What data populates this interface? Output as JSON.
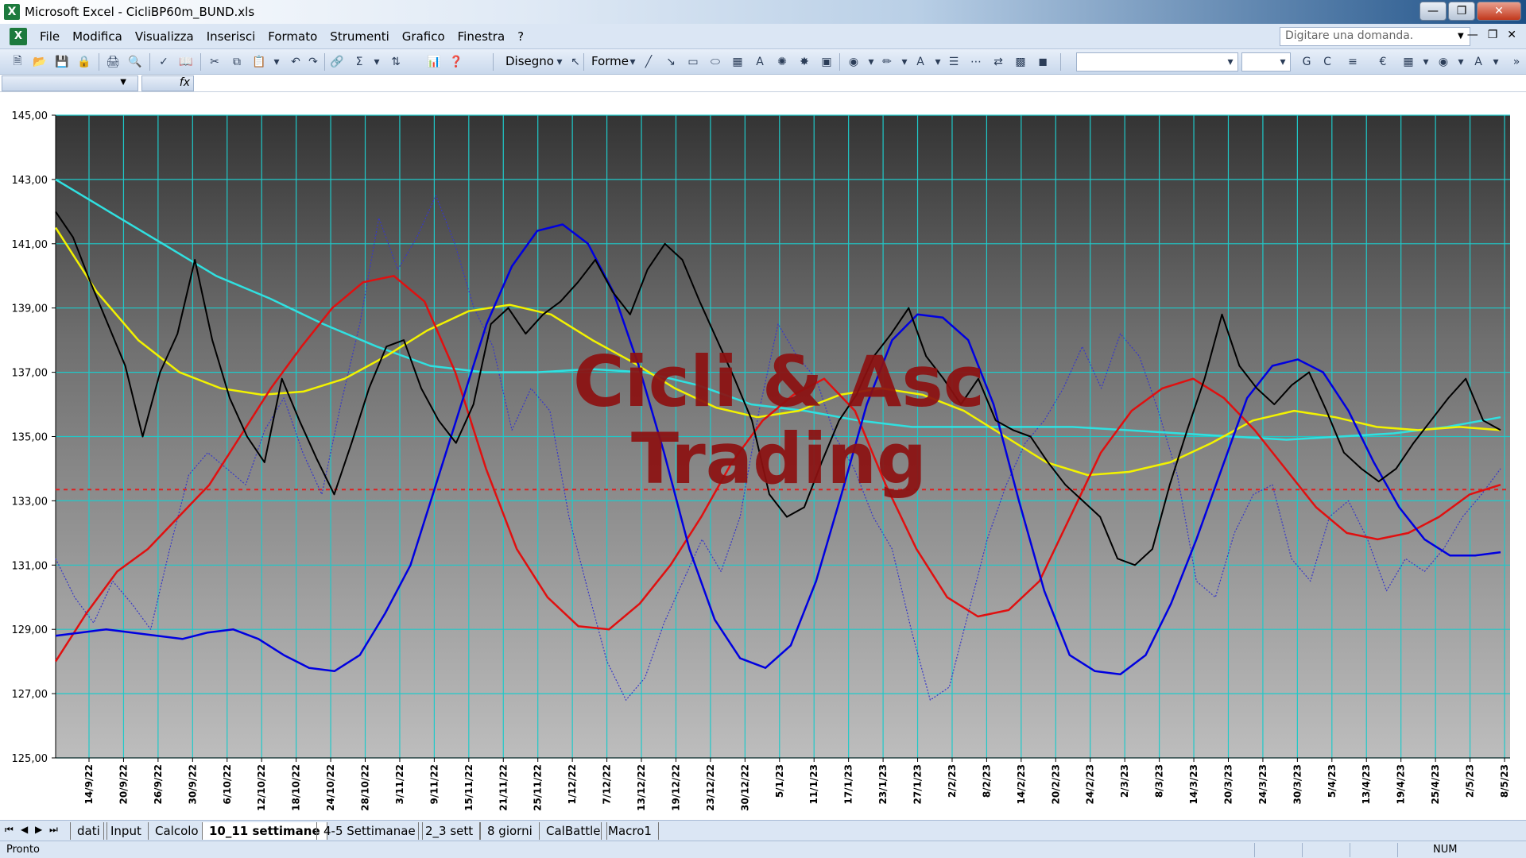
{
  "window": {
    "app_icon": "excel-icon",
    "title": "Microsoft Excel - CicliBP60m_BUND.xls"
  },
  "menu": {
    "items": [
      "File",
      "Modifica",
      "Visualizza",
      "Inserisci",
      "Formato",
      "Strumenti",
      "Grafico",
      "Finestra",
      "?"
    ],
    "ask_placeholder": "Digitare una domanda."
  },
  "toolbar": {
    "draw_label": "Disegno",
    "shapes_label": "Forme"
  },
  "formula": {
    "fx": "fx"
  },
  "sheet_tabs": {
    "labels": [
      "dati",
      "Input",
      "Calcolo",
      "10_11 settimane",
      "4-5 Settimanae",
      "2_3 sett",
      "8 giorni",
      "CalBattle",
      "Macro1"
    ],
    "active": "10_11 settimane"
  },
  "status": {
    "text": "Pronto",
    "num": "NUM"
  },
  "colors": {
    "gridline": "#1fc9c9",
    "price": "#000000",
    "cycle_blue": "#0000e0",
    "ma_red": "#e01010",
    "ma_yellow": "#f2f200",
    "ma_cyan": "#30e0e0",
    "dotted": "#3838c8",
    "hline": "#e02020",
    "watermark": "#8c1010"
  },
  "chart_data": {
    "type": "line",
    "title": "",
    "watermark": [
      "Cicli & Asc",
      "Trading"
    ],
    "ylim": [
      125,
      145
    ],
    "y_ticks": [
      "145,00",
      "143,00",
      "141,00",
      "139,00",
      "137,00",
      "135,00",
      "133,00",
      "131,00",
      "129,00",
      "127,00",
      "125,00"
    ],
    "x_labels": [
      "14/9/22",
      "20/9/22",
      "26/9/22",
      "30/9/22",
      "6/10/22",
      "12/10/22",
      "18/10/22",
      "24/10/22",
      "28/10/22",
      "3/11/22",
      "9/11/22",
      "15/11/22",
      "21/11/22",
      "25/11/22",
      "1/12/22",
      "7/12/22",
      "13/12/22",
      "19/12/22",
      "23/12/22",
      "30/12/22",
      "5/1/23",
      "11/1/23",
      "17/1/23",
      "23/1/23",
      "27/1/23",
      "2/2/23",
      "8/2/23",
      "14/2/23",
      "20/2/23",
      "24/2/23",
      "2/3/23",
      "8/3/23",
      "14/3/23",
      "20/3/23",
      "24/3/23",
      "30/3/23",
      "5/4/23",
      "13/4/23",
      "19/4/23",
      "25/4/23",
      "2/5/23",
      "8/5/23"
    ],
    "horizontal_line": 133.35,
    "grid": true,
    "series": [
      {
        "key": "price",
        "style": "solid-thin",
        "values": [
          142.0,
          141.2,
          139.8,
          138.5,
          137.2,
          135.0,
          137.0,
          138.2,
          140.5,
          138.0,
          136.2,
          135.0,
          134.2,
          136.8,
          135.5,
          134.3,
          133.2,
          134.8,
          136.5,
          137.8,
          138.0,
          136.5,
          135.5,
          134.8,
          136.0,
          138.5,
          139.0,
          138.2,
          138.8,
          139.2,
          139.8,
          140.5,
          139.5,
          138.8,
          140.2,
          141.0,
          140.5,
          139.2,
          138.0,
          136.8,
          135.5,
          133.2,
          132.5,
          132.8,
          134.2,
          135.5,
          136.3,
          137.5,
          138.2,
          139.0,
          137.5,
          136.8,
          136.0,
          136.8,
          135.5,
          135.2,
          135.0,
          134.2,
          133.5,
          133.0,
          132.5,
          131.2,
          131.0,
          131.5,
          133.5,
          135.2,
          136.8,
          138.8,
          137.2,
          136.5,
          136.0,
          136.6,
          137.0,
          135.8,
          134.5,
          134.0,
          133.6,
          134.0,
          134.8,
          135.5,
          136.2,
          136.8,
          135.5,
          135.2
        ]
      },
      {
        "key": "dotted",
        "style": "dotted",
        "values": [
          131.2,
          130.0,
          129.2,
          130.5,
          129.8,
          129.0,
          131.5,
          133.8,
          134.5,
          134.0,
          133.5,
          135.2,
          136.2,
          134.5,
          133.2,
          136.0,
          138.5,
          141.8,
          140.2,
          141.2,
          142.5,
          141.0,
          139.0,
          137.8,
          135.2,
          136.5,
          135.8,
          132.5,
          130.2,
          128.0,
          126.8,
          127.5,
          129.2,
          130.5,
          131.8,
          130.8,
          132.5,
          135.8,
          138.5,
          137.5,
          136.8,
          135.0,
          134.0,
          132.5,
          131.5,
          129.0,
          126.8,
          127.2,
          129.5,
          131.8,
          133.5,
          134.8,
          135.5,
          136.5,
          137.8,
          136.5,
          138.2,
          137.5,
          135.8,
          133.8,
          130.5,
          130.0,
          132.0,
          133.2,
          133.5,
          131.2,
          130.5,
          132.5,
          133.0,
          131.8,
          130.2,
          131.2,
          130.8,
          131.5,
          132.5,
          133.2,
          134.0
        ]
      },
      {
        "key": "cycle_blue",
        "style": "solid",
        "values": [
          128.8,
          128.9,
          129.0,
          128.9,
          128.8,
          128.7,
          128.9,
          129.0,
          128.7,
          128.2,
          127.8,
          127.7,
          128.2,
          129.5,
          131.0,
          133.5,
          136.0,
          138.5,
          140.3,
          141.4,
          141.6,
          141.0,
          139.5,
          137.2,
          134.5,
          131.5,
          129.3,
          128.1,
          127.8,
          128.5,
          130.5,
          133.2,
          136.0,
          138.0,
          138.8,
          138.7,
          138.0,
          136.0,
          133.0,
          130.2,
          128.2,
          127.7,
          127.6,
          128.2,
          129.8,
          131.8,
          134.0,
          136.2,
          137.2,
          137.4,
          137.0,
          135.8,
          134.2,
          132.8,
          131.8,
          131.3,
          131.3,
          131.4
        ]
      },
      {
        "key": "ma_red",
        "style": "solid",
        "values": [
          128.0,
          129.5,
          130.8,
          131.5,
          132.5,
          133.5,
          135.0,
          136.5,
          137.8,
          139.0,
          139.8,
          140.0,
          139.2,
          137.0,
          134.0,
          131.5,
          130.0,
          129.1,
          129.0,
          129.8,
          131.0,
          132.5,
          134.2,
          135.5,
          136.3,
          136.8,
          135.8,
          133.5,
          131.5,
          130.0,
          129.4,
          129.6,
          130.5,
          132.5,
          134.5,
          135.8,
          136.5,
          136.8,
          136.2,
          135.2,
          134.0,
          132.8,
          132.0,
          131.8,
          132.0,
          132.5,
          133.2,
          133.5
        ]
      },
      {
        "key": "ma_yellow",
        "style": "solid",
        "values": [
          141.5,
          139.5,
          138.0,
          137.0,
          136.5,
          136.3,
          136.4,
          136.8,
          137.5,
          138.3,
          138.9,
          139.1,
          138.8,
          138.0,
          137.3,
          136.5,
          135.9,
          135.6,
          135.8,
          136.3,
          136.5,
          136.3,
          135.8,
          135.0,
          134.2,
          133.8,
          133.9,
          134.2,
          134.8,
          135.5,
          135.8,
          135.6,
          135.3,
          135.2,
          135.3,
          135.2
        ]
      },
      {
        "key": "ma_cyan",
        "style": "solid",
        "values": [
          143.0,
          142.0,
          141.0,
          140.0,
          139.3,
          138.5,
          137.8,
          137.2,
          137.0,
          137.0,
          137.1,
          137.0,
          136.6,
          136.0,
          135.8,
          135.5,
          135.3,
          135.3,
          135.3,
          135.3,
          135.2,
          135.1,
          135.0,
          134.9,
          135.0,
          135.1,
          135.3,
          135.6
        ]
      }
    ]
  }
}
